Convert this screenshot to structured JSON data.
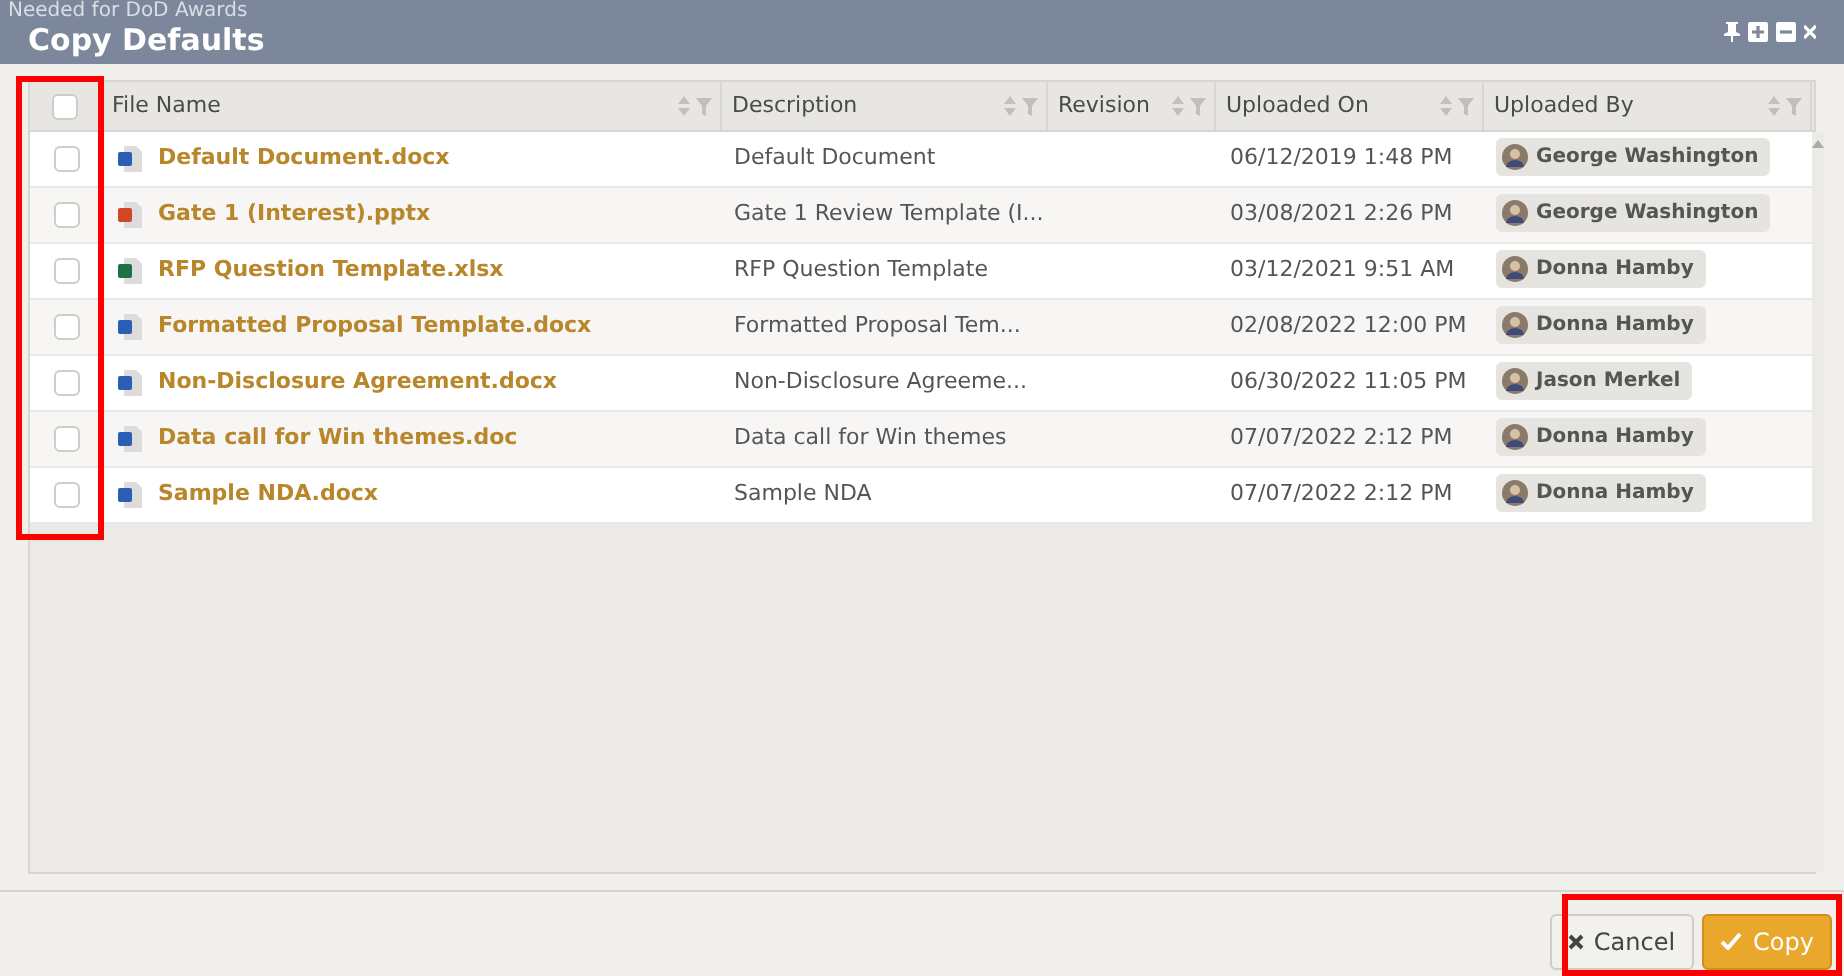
{
  "background_text": "Needed for DoD Awards",
  "window": {
    "title": "Copy Defaults"
  },
  "header_checkbox": {
    "checked": false
  },
  "columns": [
    "File Name",
    "Description",
    "Revision",
    "Uploaded On",
    "Uploaded By"
  ],
  "rows": [
    {
      "checked": false,
      "kind": "word",
      "file_name": "Default Document.docx",
      "description": "Default Document",
      "uploaded_on": "06/12/2019 1:48 PM",
      "uploaded_by": "George Washington"
    },
    {
      "checked": false,
      "kind": "powerpoint",
      "file_name": "Gate 1 (Interest).pptx",
      "description": "Gate 1 Review Template (I...",
      "uploaded_on": "03/08/2021 2:26 PM",
      "uploaded_by": "George Washington"
    },
    {
      "checked": false,
      "kind": "excel",
      "file_name": "RFP Question Template.xlsx",
      "description": "RFP Question Template",
      "uploaded_on": "03/12/2021 9:51 AM",
      "uploaded_by": "Donna Hamby"
    },
    {
      "checked": false,
      "kind": "word",
      "file_name": "Formatted Proposal Template.docx",
      "description": "Formatted Proposal Tem...",
      "uploaded_on": "02/08/2022 12:00 PM",
      "uploaded_by": "Donna Hamby"
    },
    {
      "checked": false,
      "kind": "word",
      "file_name": "Non-Disclosure Agreement.docx",
      "description": "Non-Disclosure Agreeme...",
      "uploaded_on": "06/30/2022 11:05 PM",
      "uploaded_by": "Jason Merkel"
    },
    {
      "checked": false,
      "kind": "word",
      "file_name": "Data call for Win themes.doc",
      "description": "Data call for Win themes",
      "uploaded_on": "07/07/2022 2:12 PM",
      "uploaded_by": "Donna Hamby"
    },
    {
      "checked": false,
      "kind": "word",
      "file_name": "Sample NDA.docx",
      "description": "Sample NDA",
      "uploaded_on": "07/07/2022 2:12 PM",
      "uploaded_by": "Donna Hamby"
    }
  ],
  "buttons": [
    {
      "kind": "cancel",
      "label": "Cancel"
    },
    {
      "kind": "confirm",
      "label": "Copy"
    }
  ]
}
